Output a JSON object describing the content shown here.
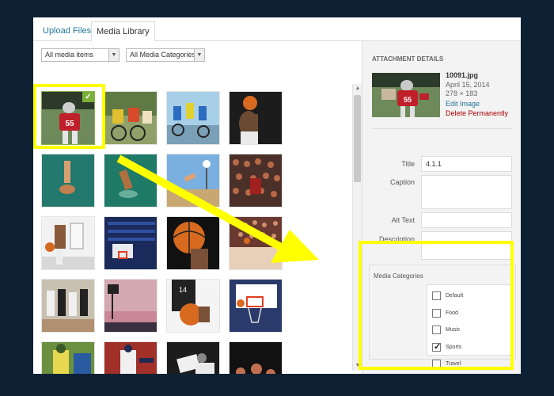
{
  "tabs": [
    {
      "label": "Upload Files",
      "active": false
    },
    {
      "label": "Media Library",
      "active": true
    }
  ],
  "filters": {
    "media_type": "All media items",
    "category": "All Media Categories"
  },
  "details": {
    "heading": "ATTACHMENT DETAILS",
    "filename": "10091.jpg",
    "date": "April 15, 2014",
    "dimensions": "278 × 183",
    "edit_label": "Edit Image",
    "delete_label": "Delete Permanently"
  },
  "fields": [
    {
      "label": "Title",
      "value": "4.1.1"
    },
    {
      "label": "Caption",
      "value": ""
    },
    {
      "label": "Alt Text",
      "value": ""
    },
    {
      "label": "Description",
      "value": ""
    }
  ],
  "media_categories": {
    "heading": "Media Categories",
    "items": [
      {
        "label": "Default",
        "checked": false
      },
      {
        "label": "Food",
        "checked": false
      },
      {
        "label": "Music",
        "checked": false
      },
      {
        "label": "Sports",
        "checked": true
      },
      {
        "label": "Travel",
        "checked": false
      }
    ]
  },
  "thumbnails": [
    "football-player",
    "cyclists-racing",
    "cyclists-group",
    "basketball-shooter",
    "diver-underwater",
    "diver-pool",
    "volleyball-beach",
    "stadium-crowd",
    "basketball-players",
    "basketball-hoop-arena",
    "basketball-closeup",
    "arena-crowd",
    "basketball-team-game",
    "sunset-hoop",
    "basketball-hand",
    "basketball-net",
    "baseball-player",
    "baseball-pitcher",
    "football-tackle",
    "crowd-cheering"
  ],
  "colors": {
    "highlight": "#ffff00",
    "link": "#21759b",
    "delete": "#aa0000",
    "background": "#0e2033"
  }
}
